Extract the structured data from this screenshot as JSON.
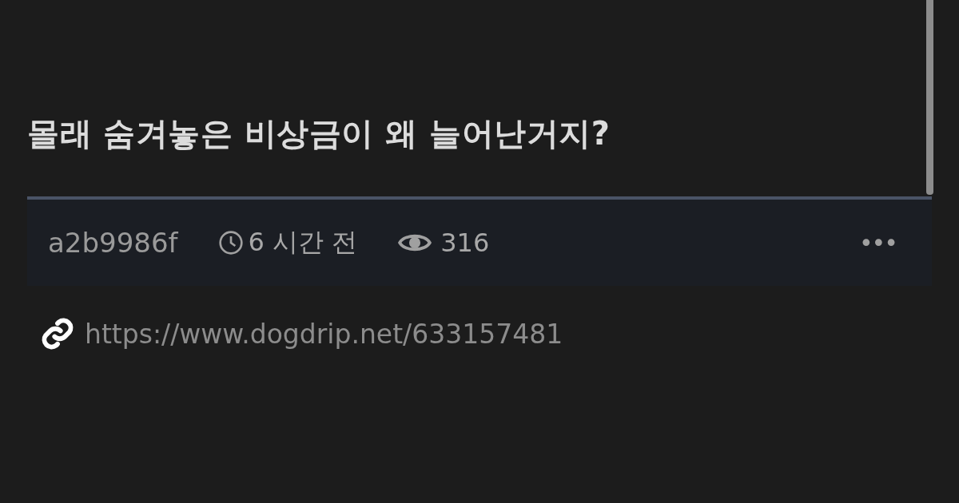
{
  "post": {
    "title": "몰래 숨겨놓은 비상금이 왜 늘어난거지?",
    "author": "a2b9986f",
    "time": "6 시간 전",
    "views": "316",
    "more": "•••",
    "url": "https://www.dogdrip.net/633157481"
  }
}
